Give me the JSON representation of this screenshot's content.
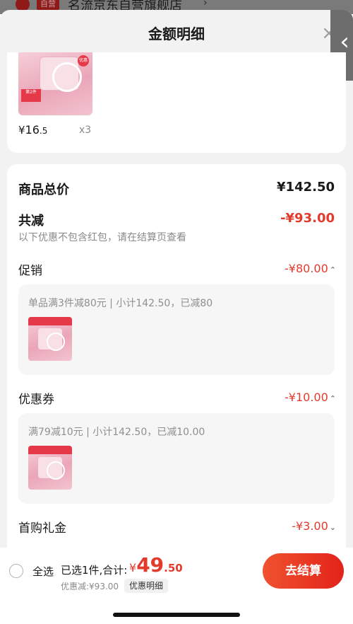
{
  "background": {
    "store_tag": "自营",
    "store_name": "名流京东自营旗舰店",
    "store_arrow": "›"
  },
  "sheet": {
    "title": "金额明细",
    "close_glyph": "×",
    "back_glyph": "‹"
  },
  "product": {
    "price_currency": "¥",
    "price_int": "16",
    "price_dec": ".5",
    "quantity": "x3",
    "image_badge_text": "第2件",
    "image_dot_text": "优惠"
  },
  "summary": {
    "total_label": "商品总价",
    "total_value": "¥142.50",
    "reduce_label": "共减",
    "reduce_value": "-¥93.00",
    "note": "以下优惠不包含红包，请在结算页查看"
  },
  "promotion": {
    "label": "促销",
    "value": "-¥80.00",
    "chevron": "⌃",
    "detail": "单品满3件减80元 | 小计142.50，已减80"
  },
  "coupon": {
    "label": "优惠券",
    "value": "-¥10.00",
    "chevron": "⌃",
    "detail": "满79减10元 | 小计142.50，已减10.00"
  },
  "first_purchase": {
    "label": "首购礼金",
    "value": "-¥3.00",
    "chevron": "⌄"
  },
  "bottom_bar": {
    "select_all": "全选",
    "selected_text": "已选1件,合计:",
    "total_currency": "¥",
    "total_int": "49",
    "total_dec": ".50",
    "discount_text": "优惠减:¥93.00",
    "detail_chip": "优惠明细",
    "checkout_label": "去结算"
  },
  "colors": {
    "accent_red": "#e33a2c",
    "checkout_gradient_start": "#f0522f",
    "checkout_gradient_end": "#e2231a"
  }
}
